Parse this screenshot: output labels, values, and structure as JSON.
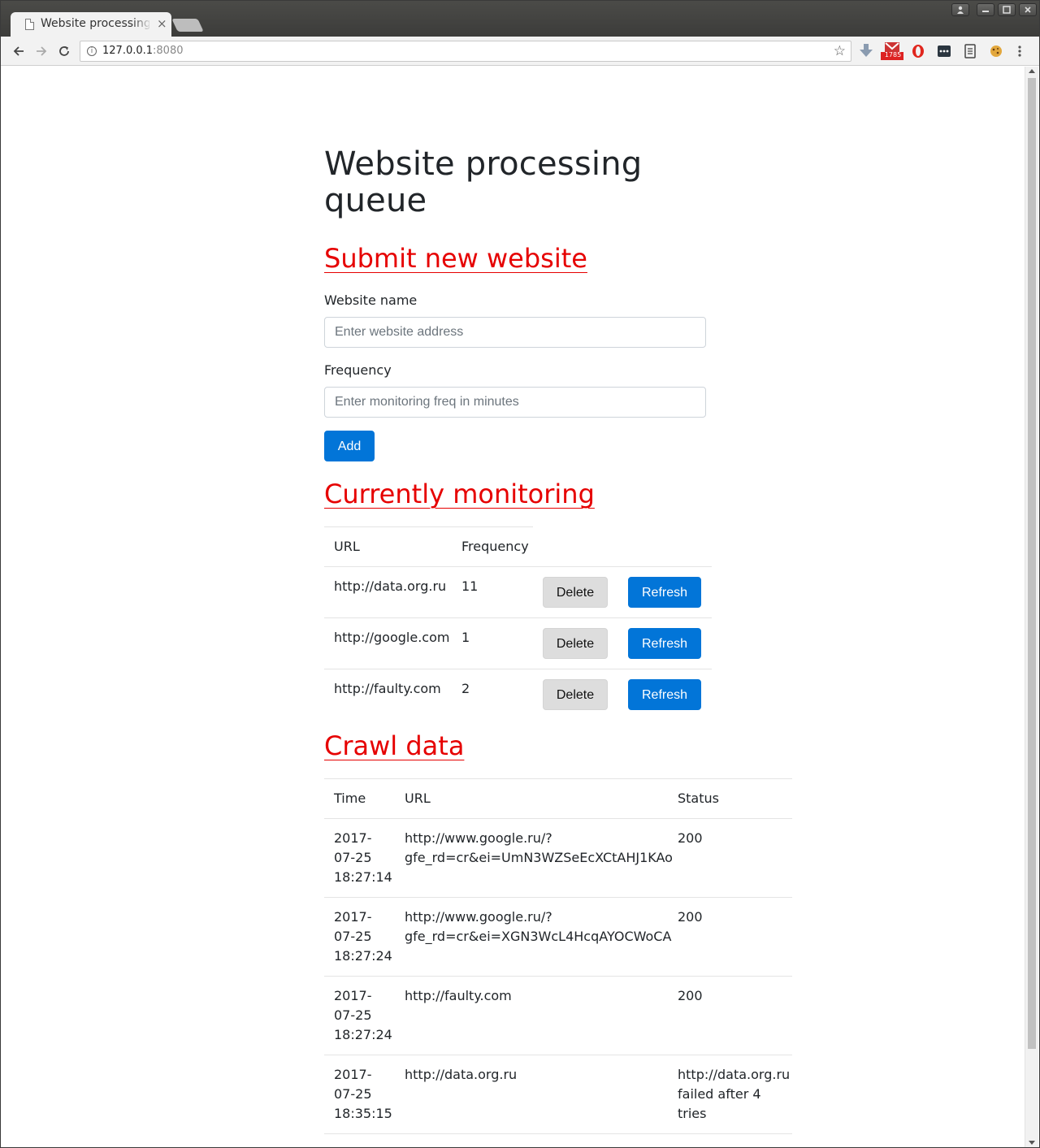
{
  "browser": {
    "tab_title": "Website processing",
    "tab_close": "×",
    "url_host": "127.0.0.1",
    "url_port": ":8080",
    "gmail_badge": "1785"
  },
  "page": {
    "title_line1": "Website processing",
    "title_line2": "queue"
  },
  "submit": {
    "heading": "Submit new website",
    "name_label": "Website name",
    "name_placeholder": "Enter website address",
    "freq_label": "Frequency",
    "freq_placeholder": "Enter monitoring freq in minutes",
    "add_label": "Add"
  },
  "monitoring": {
    "heading": "Currently monitoring",
    "col_url": "URL",
    "col_freq": "Frequency",
    "delete_label": "Delete",
    "refresh_label": "Refresh",
    "rows": [
      {
        "url": "http://data.org.ru",
        "freq": "11"
      },
      {
        "url": "http://google.com",
        "freq": "1"
      },
      {
        "url": "http://faulty.com",
        "freq": "2"
      }
    ]
  },
  "crawl": {
    "heading": "Crawl data",
    "col_time": "Time",
    "col_url": "URL",
    "col_status": "Status",
    "rows": [
      {
        "time": [
          "2017-",
          "07-25",
          "18:27:14"
        ],
        "url": [
          "http://www.google.ru/?",
          "gfe_rd=cr&ei=UmN3WZSeEcXCtAHJ1KAo"
        ],
        "status": [
          "200"
        ]
      },
      {
        "time": [
          "2017-",
          "07-25",
          "18:27:24"
        ],
        "url": [
          "http://www.google.ru/?",
          "gfe_rd=cr&ei=XGN3WcL4HcqAYOCWoCA"
        ],
        "status": [
          "200"
        ]
      },
      {
        "time": [
          "2017-",
          "07-25",
          "18:27:24"
        ],
        "url": [
          "http://faulty.com"
        ],
        "status": [
          "200"
        ]
      },
      {
        "time": [
          "2017-",
          "07-25",
          "18:35:15"
        ],
        "url": [
          "http://data.org.ru"
        ],
        "status": [
          "http://data.org.ru",
          "failed after 4",
          "tries"
        ]
      }
    ]
  }
}
